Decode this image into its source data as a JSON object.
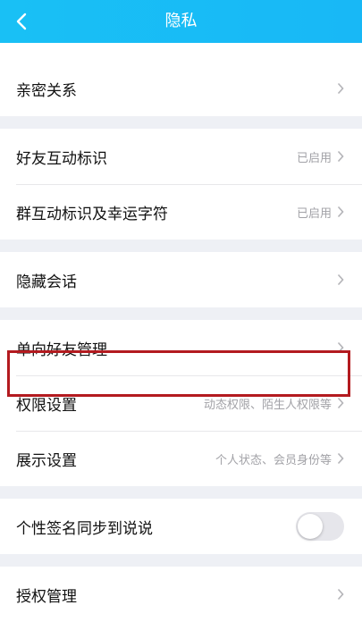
{
  "header": {
    "title": "隐私",
    "back_icon": "chevron-left-icon",
    "background_color": "#19c0f5"
  },
  "rows": {
    "intimate": {
      "label": "亲密关系"
    },
    "friend_interaction": {
      "label": "好友互动标识",
      "value": "已启用"
    },
    "group_interaction": {
      "label": "群互动标识及幸运字符",
      "value": "已启用"
    },
    "hidden_chats": {
      "label": "隐藏会话"
    },
    "one_way_friends": {
      "label": "单向好友管理"
    },
    "permissions": {
      "label": "权限设置",
      "value": "动态权限、陌生人权限等"
    },
    "display": {
      "label": "展示设置",
      "value": "个人状态、会员身份等"
    },
    "signature_sync": {
      "label": "个性签名同步到说说",
      "toggle_on": false
    },
    "authorization": {
      "label": "授权管理"
    }
  },
  "highlight_color": "#b31a1f"
}
